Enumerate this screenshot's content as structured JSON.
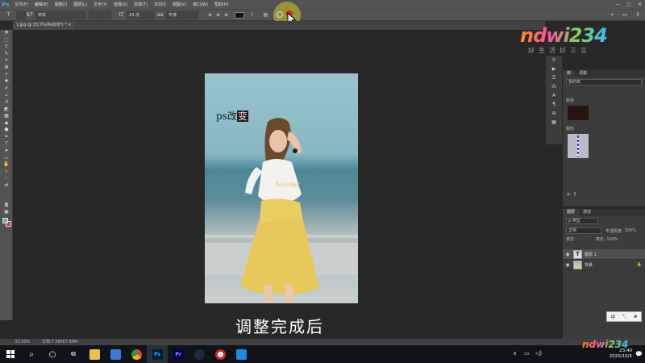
{
  "app": {
    "logo": "Ps"
  },
  "menu": [
    "文件(F)",
    "编辑(E)",
    "图像(I)",
    "图层(L)",
    "文字(Y)",
    "选择(S)",
    "滤镜(T)",
    "3D(D)",
    "视图(V)",
    "窗口(W)",
    "帮助(H)"
  ],
  "window_controls": {
    "minimize": "—",
    "restore": "▢",
    "close": "✕"
  },
  "options_bar": {
    "tool_icon": "T",
    "orient_icon": "⇅T",
    "font_family": "宋体",
    "font_style": "",
    "size_icon": "tT",
    "font_size": "24 点",
    "aa_icon": "aa",
    "anti_alias": "平滑",
    "text_color": "#111111"
  },
  "doc_tab": {
    "title": "1.jpg @ 33.3%(RGB/8*) *  ✕"
  },
  "canvas": {
    "text_plain": "ps改",
    "text_selected": "变",
    "subtitle": "调整完成后"
  },
  "panels": {
    "tabs_top": [
      "库",
      "调整"
    ],
    "library_select": "我的库",
    "color_label": "颜色",
    "pattern_label": "图形",
    "tabs_layers": [
      "图层",
      "通道"
    ],
    "filter_type": "ρ 类型",
    "blend_mode": "正常",
    "opacity_label": "不透明度:",
    "opacity": "100%",
    "lock_label": "锁定:",
    "fill_label": "填充:",
    "fill": "100%",
    "layers": [
      {
        "name": "图层 1",
        "kind": "T",
        "selected": true
      },
      {
        "name": "背景",
        "kind": "photo",
        "selected": false
      }
    ]
  },
  "ime": {
    "lang": "中",
    "punct": "°,",
    "shape": "⊕"
  },
  "status": {
    "zoom": "33.33%",
    "doc": "文档:7.58M/7.60M"
  },
  "tray": {
    "time": "23:40",
    "date": "2020/10/5",
    "notify": "💬"
  },
  "watermark": {
    "brand": "ndwi234",
    "slogan": "好生活好三言"
  },
  "colors": {
    "ps_blue": "#31a8ff",
    "commit_red": "#e02020",
    "bg_swatch": "#e03050",
    "fg_swatch": "#7fa9c5"
  }
}
